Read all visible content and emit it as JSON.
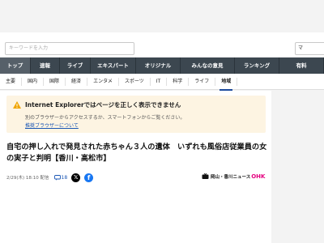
{
  "search": {
    "placeholder": "キーワードを入力",
    "right_text": "マ"
  },
  "mainnav": [
    {
      "label": "トップ",
      "active": true
    },
    {
      "label": "速報",
      "active": false
    },
    {
      "label": "ライブ",
      "active": false
    },
    {
      "label": "エキスパート",
      "active": false
    },
    {
      "label": "オリジナル",
      "active": false
    },
    {
      "label": "みんなの意見",
      "active": false
    },
    {
      "label": "ランキング",
      "active": false
    },
    {
      "label": "有料",
      "active": false
    }
  ],
  "subnav": [
    {
      "label": "主要",
      "active": false
    },
    {
      "label": "国内",
      "active": false
    },
    {
      "label": "国際",
      "active": false
    },
    {
      "label": "経済",
      "active": false
    },
    {
      "label": "エンタメ",
      "active": false
    },
    {
      "label": "スポーツ",
      "active": false
    },
    {
      "label": "IT",
      "active": false
    },
    {
      "label": "科学",
      "active": false
    },
    {
      "label": "ライフ",
      "active": false
    },
    {
      "label": "地域",
      "active": true
    }
  ],
  "warning": {
    "title": "Internet Explorerではページを正しく表示できません",
    "text": "別のブラウザーからアクセスするか、スマートフォンからご覧ください。",
    "link": "推奨ブラウザーについて",
    "icon": "warning-icon",
    "color": "#f0a500"
  },
  "article": {
    "headline": "自宅の押し入れで発見された赤ちゃん３人の遺体　いずれも風俗店従業員の女の実子と判明【香川・高松市】",
    "date": "2/29(木) 18:10 配信",
    "comment_count": "18",
    "source_name": "岡山・香川ニュース",
    "source_brand": "OHK"
  }
}
